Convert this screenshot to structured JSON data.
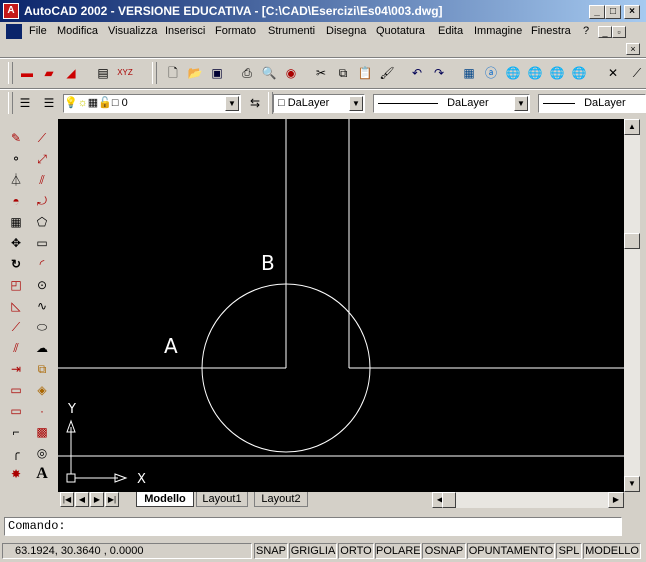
{
  "window": {
    "title": "AutoCAD 2002 - VERSIONE EDUCATIVA - [C:\\CAD\\Esercizi\\Es04\\003.dwg]"
  },
  "menu": [
    "File",
    "Modifica",
    "Visualizza",
    "Inserisci",
    "Formato",
    "Strumenti",
    "Disegna",
    "Quotatura",
    "Edita",
    "Immagine",
    "Finestra",
    "?"
  ],
  "layer": {
    "name": "0"
  },
  "properties": {
    "color": "DaLayer",
    "linetype": "DaLayer",
    "lineweight": "DaLayer"
  },
  "drawing": {
    "label_a": "A",
    "label_b": "B",
    "ucs_x": "X",
    "ucs_y": "Y"
  },
  "layout_tabs": [
    "Modello",
    "Layout1",
    "Layout2"
  ],
  "command": {
    "prompt": "Comando:"
  },
  "status": {
    "coords": "63.1924, 30.3640 , 0.0000",
    "toggles": [
      "SNAP",
      "GRIGLIA",
      "ORTO",
      "POLARE",
      "OSNAP",
      "OPUNTAMENTO",
      "SPL",
      "MODELLO"
    ]
  },
  "colors": {
    "titlebar_start": "#0a246a",
    "titlebar_end": "#a6caf0",
    "canvas": "#000000",
    "entity": "#ffffff"
  }
}
